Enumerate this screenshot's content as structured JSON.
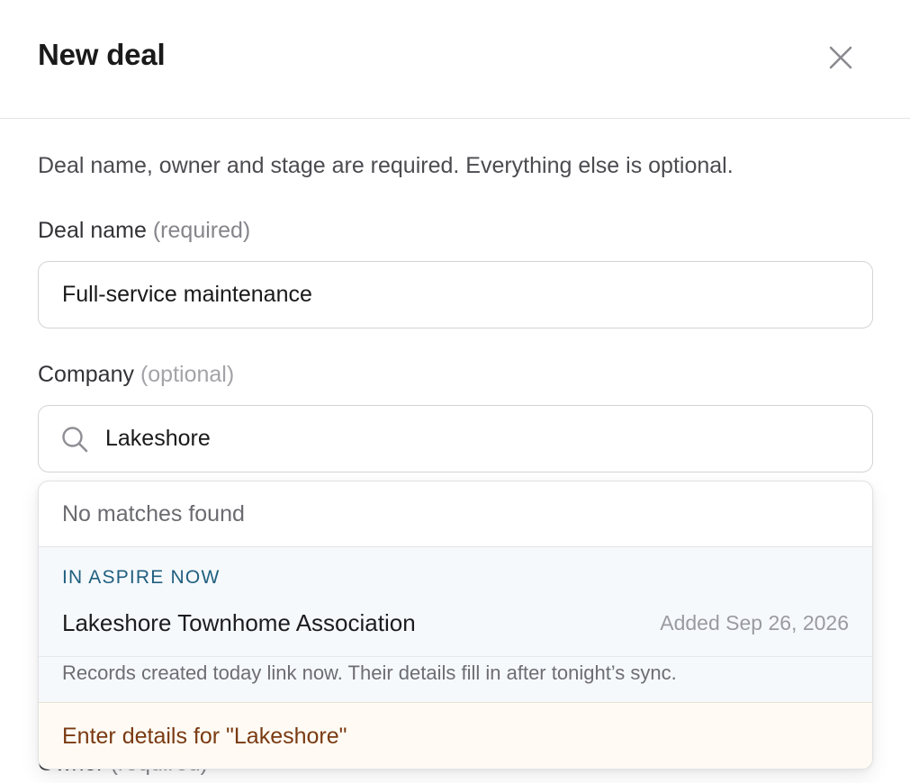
{
  "modal": {
    "title": "New deal",
    "intro": "Deal name, owner and stage are required. Everything else is optional."
  },
  "deal_name": {
    "label": "Deal name",
    "hint": "(required)",
    "value": "Full-service maintenance"
  },
  "company": {
    "label": "Company",
    "hint": "(optional)",
    "value": "Lakeshore"
  },
  "dropdown": {
    "empty_text": "No matches found",
    "section_heading": "IN ASPIRE NOW",
    "result_name": "Lakeshore Townhome Association",
    "result_date": "Added Sep 26, 2026",
    "sync_note": "Records created today link now. Their details fill in after tonight’s sync.",
    "enter_details": "Enter details for \"Lakeshore\""
  },
  "owner": {
    "label": "Owner",
    "hint": "(required)"
  },
  "icons": {
    "close": "close-icon",
    "search": "search-icon"
  }
}
